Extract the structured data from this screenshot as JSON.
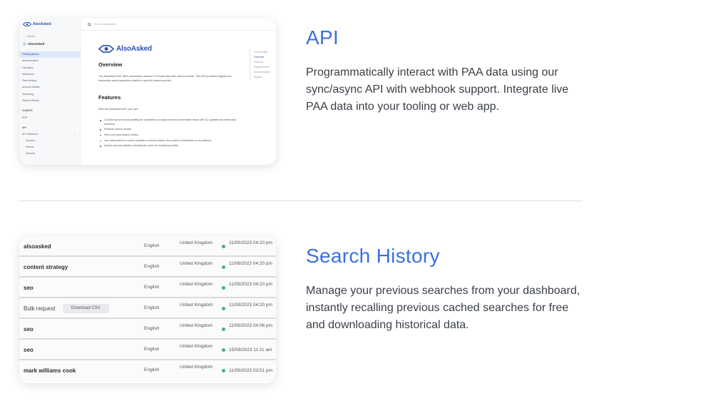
{
  "api": {
    "title": "API",
    "description": "Programmatically interact with PAA data using our sync/async API with webhook support. Integrate live PAA data into your tooling or web app.",
    "docs": {
      "sidebar_logo": "AlsoAsked",
      "home_link": "← Home",
      "brand": "AlsoAsked",
      "nav_items": [
        "Getting started",
        "Authentication",
        "Operation",
        "Webhooks",
        "Rate limiting",
        "Account details",
        "Searching",
        "Search History"
      ],
      "group_clients": "CLIENTS",
      "clients_item": "PHP",
      "group_api": "API",
      "api_reference": "API reference",
      "api_sub_items": [
        "Account",
        "Search",
        "Schema"
      ],
      "search_placeholder": "Search AlsoAsked...",
      "logo_text": "AlsoAsked",
      "overview_heading": "Overview",
      "overview_text": "The AlsoAsked API offers developers access to 'People Also Ask' search results. This API provides insights into frequently asked questions related to specific search queries.",
      "features_heading": "Features",
      "features_intro": "With the AlsoAsked API, you can:",
      "features": [
        "Conduct synchronous (waiting for completion) or asynchronous (immediate return with ID, updates via webhooks) searches.",
        "Retrieve search results.",
        "View your past search history.",
        "Use webhooses to receive updates on search status, from start to completion or any failures.",
        "Access account details, including the count of remaining credits."
      ],
      "on_this_page_title": "On this page",
      "on_this_page": [
        "Overview",
        "Features",
        "Requirements",
        "Documentation",
        "Support"
      ]
    }
  },
  "history": {
    "title": "Search History",
    "description": "Manage your previous searches from your dashboard, instantly recalling previous cached searches for free and downloading historical data.",
    "download_label": "Download CSV",
    "status_color": "#3fb48a",
    "rows": [
      {
        "term": "alsoasked",
        "language": "English",
        "country": "United Kingdom",
        "date": "11/09/2023 04:20 pm"
      },
      {
        "term": "content strategy",
        "language": "English",
        "country": "United Kingdom",
        "date": "11/09/2023 04:20 pm"
      },
      {
        "term": "seo",
        "language": "English",
        "country": "United Kingdom",
        "date": "11/09/2023 04:20 pm"
      },
      {
        "term": "Bulk request",
        "language": "English",
        "country": "United Kingdom",
        "date": "11/09/2023 04:20 pm"
      },
      {
        "term": "seo",
        "language": "English",
        "country": "United Kingdom",
        "date": "11/09/2023 04:06 pm"
      },
      {
        "term": "seo",
        "language": "English",
        "country": "United Kingdom",
        "date": "15/08/2023 11:11 am"
      },
      {
        "term": "mark williams cook",
        "language": "English",
        "country": "United Kingdom",
        "date": "11/09/2023 03:51 pm"
      }
    ]
  },
  "colors": {
    "accent": "#3b6fe0",
    "brand_blue": "#2b4fb3"
  }
}
